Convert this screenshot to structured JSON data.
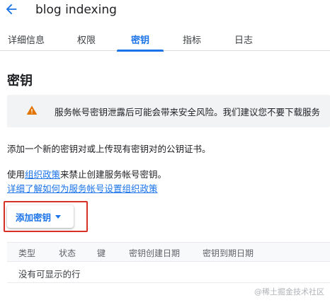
{
  "header": {
    "back_icon": "arrow-left-icon",
    "title": "blog indexing"
  },
  "tabs": [
    {
      "label": "详细信息",
      "active": false
    },
    {
      "label": "权限",
      "active": false
    },
    {
      "label": "密钥",
      "active": true
    },
    {
      "label": "指标",
      "active": false
    },
    {
      "label": "日志",
      "active": false
    }
  ],
  "main": {
    "section_title": "密钥",
    "warning": {
      "icon": "warning-icon",
      "text": "服务帐号密钥泄露后可能会带来安全风险。我们建议您不要下载服务"
    },
    "intro": "添加一个新的密钥对或上传现有密钥对的公钥证书。",
    "policy_prefix": "使用",
    "policy_link": "组织政策",
    "policy_suffix": "来禁止创建服务帐号密钥。",
    "learn_more_link": "详细了解如何为服务帐号设置组织政策",
    "add_key_button": "添加密钥",
    "table": {
      "columns": [
        "类型",
        "状态",
        "键",
        "密钥创建日期",
        "密钥到期日期"
      ],
      "empty_text": "没有可显示的行"
    }
  },
  "watermark": "@稀土掘金技术社区",
  "colors": {
    "accent": "#1a73e8",
    "warning": "#e37400",
    "highlight": "#d93025"
  }
}
